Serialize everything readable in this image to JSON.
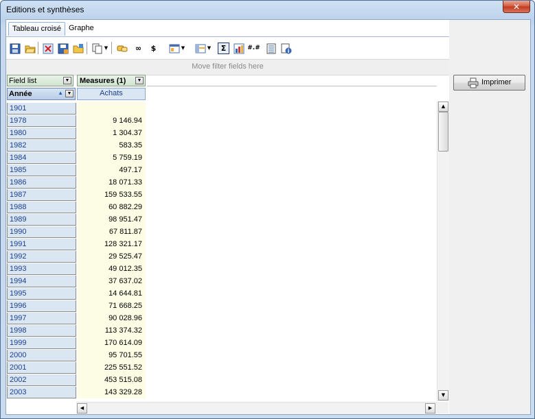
{
  "window": {
    "title": "Editions et synthèses",
    "close_glyph": "✕"
  },
  "tabs": [
    {
      "label": "Tableau croisé"
    },
    {
      "label": "Graphe"
    }
  ],
  "toolbar": {
    "icons": [
      "save-icon",
      "open-icon",
      "delete-icon",
      "save-as-icon",
      "open-folder-icon",
      "copy-icon",
      "dropdown-arrow-icon",
      "link-icon",
      "infinity-icon",
      "currency-icon",
      "layout-icon",
      "dropdown-arrow-icon",
      "format-icon",
      "dropdown-arrow-icon",
      "sum-icon",
      "chart-icon",
      "number-format-icon",
      "list-icon",
      "info-icon"
    ],
    "sum_glyph": "Σ",
    "infinity_glyph": "∞",
    "currency_glyph": "$",
    "number_format_glyph": "#.#"
  },
  "filter_bar": {
    "placeholder": "Move filter fields here"
  },
  "pivot": {
    "field_list_label": "Field list",
    "measures_label": "Measures (1)",
    "row_field_label": "Année",
    "measure_column": "Achats",
    "rows": [
      {
        "year": "1901",
        "value": ""
      },
      {
        "year": "1978",
        "value": "9 146.94"
      },
      {
        "year": "1980",
        "value": "1 304.37"
      },
      {
        "year": "1982",
        "value": "583.35"
      },
      {
        "year": "1984",
        "value": "5 759.19"
      },
      {
        "year": "1985",
        "value": "497.17"
      },
      {
        "year": "1986",
        "value": "18 071.33"
      },
      {
        "year": "1987",
        "value": "159 533.55"
      },
      {
        "year": "1988",
        "value": "60 882.29"
      },
      {
        "year": "1989",
        "value": "98 951.47"
      },
      {
        "year": "1990",
        "value": "67 811.87"
      },
      {
        "year": "1991",
        "value": "128 321.17"
      },
      {
        "year": "1992",
        "value": "29 525.47"
      },
      {
        "year": "1993",
        "value": "49 012.35"
      },
      {
        "year": "1994",
        "value": "37 637.02"
      },
      {
        "year": "1995",
        "value": "14 644.81"
      },
      {
        "year": "1996",
        "value": "71 668.25"
      },
      {
        "year": "1997",
        "value": "90 028.96"
      },
      {
        "year": "1998",
        "value": "113 374.32"
      },
      {
        "year": "1999",
        "value": "170 614.09"
      },
      {
        "year": "2000",
        "value": "95 701.55"
      },
      {
        "year": "2001",
        "value": "225 551.52"
      },
      {
        "year": "2002",
        "value": "453 515.08"
      },
      {
        "year": "2003",
        "value": "143 329.28"
      }
    ]
  },
  "buttons": {
    "print_label": "Imprimer"
  }
}
